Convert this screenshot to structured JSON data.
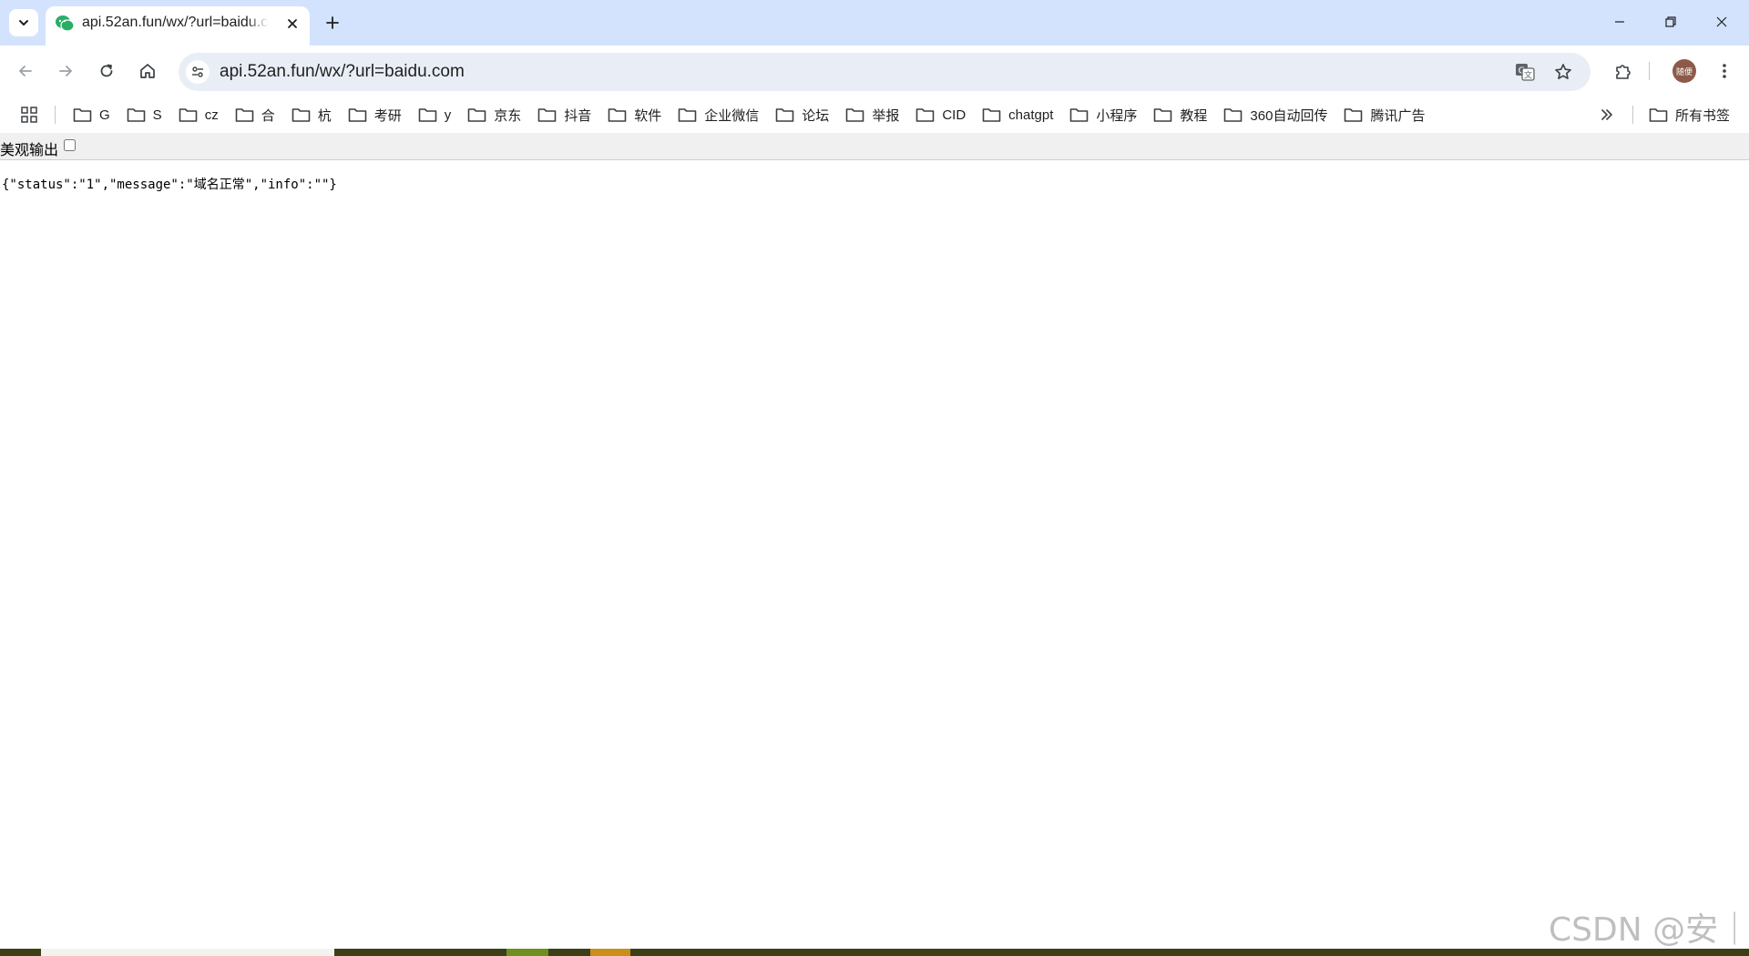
{
  "browser": {
    "tab": {
      "title": "api.52an.fun/wx/?url=baidu.com",
      "favicon": "wechat-icon"
    },
    "toolbar": {
      "url": "api.52an.fun/wx/?url=baidu.com",
      "profile_label": "随便"
    },
    "bookmarks": {
      "items": [
        {
          "label": "G"
        },
        {
          "label": "S"
        },
        {
          "label": "cz"
        },
        {
          "label": "合"
        },
        {
          "label": "杭"
        },
        {
          "label": "考研"
        },
        {
          "label": "y"
        },
        {
          "label": "京东"
        },
        {
          "label": "抖音"
        },
        {
          "label": "软件"
        },
        {
          "label": "企业微信"
        },
        {
          "label": "论坛"
        },
        {
          "label": "举报"
        },
        {
          "label": "CID"
        },
        {
          "label": "chatgpt"
        },
        {
          "label": "小程序"
        },
        {
          "label": "教程"
        },
        {
          "label": "360自动回传"
        },
        {
          "label": "腾讯广告"
        }
      ],
      "all_bookmarks_label": "所有书签"
    }
  },
  "page": {
    "pretty_print_label": "美观输出",
    "pretty_print_checked": false,
    "json_text": "{\"status\":\"1\",\"message\":\"域名正常\",\"info\":\"\"}"
  },
  "watermark": "CSDN @安｜",
  "colors": {
    "tabstrip_bg": "#d3e3fd",
    "omnibox_bg": "#e9eef6",
    "favicon_green": "#2aae67",
    "avatar_bg": "#8d5a4a"
  }
}
